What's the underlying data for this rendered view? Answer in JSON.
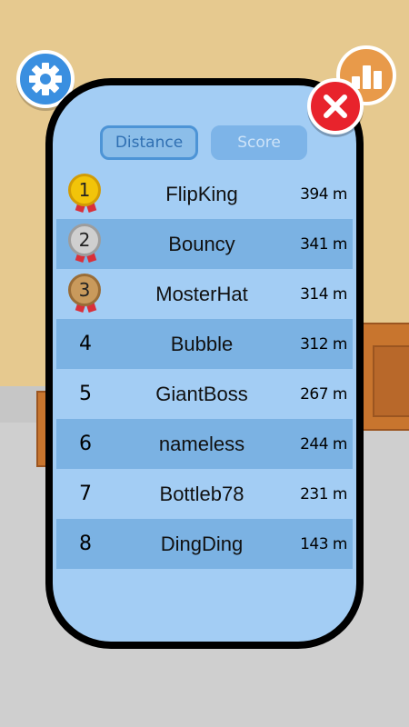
{
  "tabs": {
    "distance": "Distance",
    "score": "Score"
  },
  "leaderboard": [
    {
      "rank": "1",
      "name": "FlipKing",
      "distance": "394 m",
      "medal": "gold"
    },
    {
      "rank": "2",
      "name": "Bouncy",
      "distance": "341 m",
      "medal": "silver"
    },
    {
      "rank": "3",
      "name": "MosterHat",
      "distance": "314 m",
      "medal": "bronze"
    },
    {
      "rank": "4",
      "name": "Bubble",
      "distance": "312 m",
      "medal": ""
    },
    {
      "rank": "5",
      "name": "GiantBoss",
      "distance": "267 m",
      "medal": ""
    },
    {
      "rank": "6",
      "name": "nameless",
      "distance": "244 m",
      "medal": ""
    },
    {
      "rank": "7",
      "name": "Bottleb78",
      "distance": "231 m",
      "medal": ""
    },
    {
      "rank": "8",
      "name": "DingDing",
      "distance": "143 m",
      "medal": ""
    }
  ],
  "icons": {
    "settings": "gear-icon",
    "stats": "bar-chart-icon",
    "close": "close-icon",
    "medal": "medal-icon"
  },
  "colors": {
    "panel_bg": "#a3cdf4",
    "row_alt": "#7bb2e3",
    "close_red": "#e8232c",
    "settings_blue": "#3a8fe0",
    "stats_orange": "#e89a4a",
    "gold": "#f2c40a",
    "silver": "#cfcfcf",
    "bronze": "#c99a5c"
  }
}
